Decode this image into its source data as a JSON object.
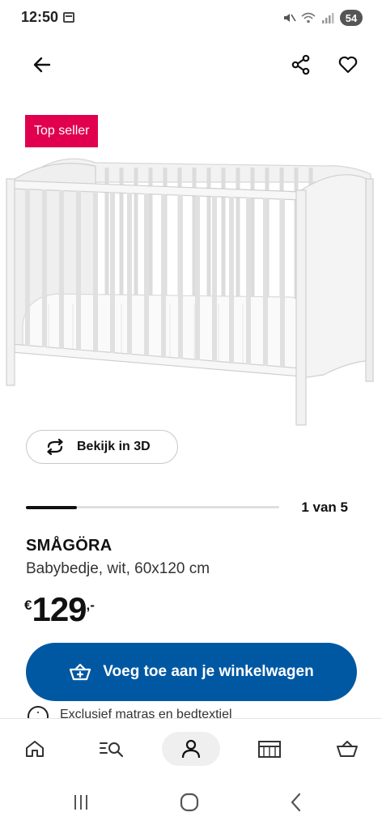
{
  "status_bar": {
    "time": "12:50",
    "battery": "54"
  },
  "badge": {
    "label": "Top seller"
  },
  "view_3d": {
    "label": "Bekijk in 3D"
  },
  "gallery": {
    "counter": "1 van 5",
    "current": 1,
    "total": 5
  },
  "product": {
    "name": "SMÅGÖRA",
    "description": "Babybedje, wit, 60x120 cm",
    "price": {
      "currency": "€",
      "integer": "129",
      "decimal": ",-"
    }
  },
  "cart_button": {
    "label": "Voeg toe aan je winkelwagen"
  },
  "info": {
    "text": "Exclusief matras en bedtextiel"
  },
  "bottom_nav": {
    "items": [
      {
        "icon": "home-icon",
        "active": false
      },
      {
        "icon": "search-list-icon",
        "active": false
      },
      {
        "icon": "profile-icon",
        "active": true
      },
      {
        "icon": "store-icon",
        "active": false
      },
      {
        "icon": "basket-icon",
        "active": false
      }
    ]
  },
  "colors": {
    "accent": "#0058a3",
    "badge": "#e0004d"
  }
}
